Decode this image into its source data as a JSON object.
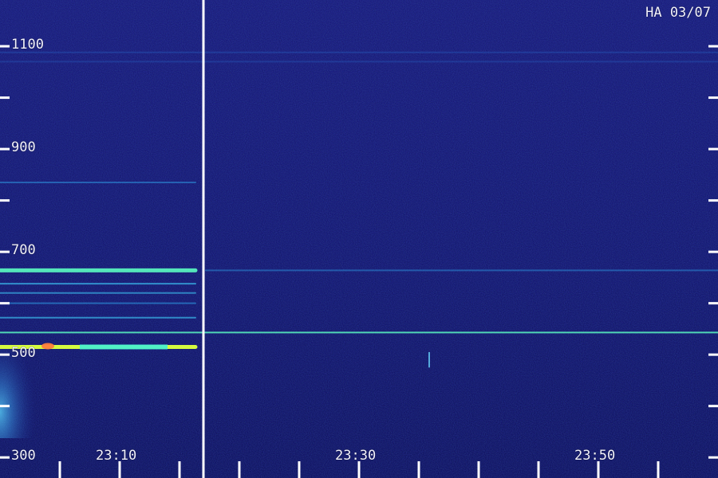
{
  "chart_data": {
    "type": "heatmap",
    "title": "HA 03/07",
    "xlabel": "",
    "ylabel": "",
    "x_ticks": [
      "23:10",
      "23:30",
      "23:50"
    ],
    "y_ticks": [
      300,
      500,
      700,
      900,
      1100
    ],
    "ylim": [
      260,
      1190
    ],
    "grid": false,
    "colors": {
      "background": "#0d0a63",
      "noise_low": "#08103e",
      "noise_high": "#2d52d4",
      "line_color": "#3ec9f7",
      "hot_color": "#d9ff3f",
      "axis_color": "#ffffff"
    },
    "features": {
      "bands": [
        {
          "frequency": 515,
          "intensity": 0.98,
          "segment": "left"
        },
        {
          "frequency": 543,
          "intensity": 0.86,
          "segment": "both"
        },
        {
          "frequency": 572,
          "intensity": 0.63,
          "segment": "left"
        },
        {
          "frequency": 600,
          "intensity": 0.55,
          "segment": "left"
        },
        {
          "frequency": 620,
          "intensity": 0.58,
          "segment": "left"
        },
        {
          "frequency": 638,
          "intensity": 0.66,
          "segment": "left"
        },
        {
          "frequency": 664,
          "intensity": 0.93,
          "segment": "left"
        },
        {
          "frequency": 664,
          "intensity": 0.45,
          "segment": "right"
        },
        {
          "frequency": 835,
          "intensity": 0.5,
          "segment": "left"
        },
        {
          "frequency": 1088,
          "intensity": 0.3,
          "segment": "both"
        },
        {
          "frequency": 1070,
          "intensity": 0.24,
          "segment": "both"
        }
      ],
      "low_frequency_glow": {
        "from": 290,
        "to": 480
      },
      "vertical_flash": {
        "time": "23:34",
        "frequency_range": [
          475,
          505
        ]
      }
    }
  }
}
